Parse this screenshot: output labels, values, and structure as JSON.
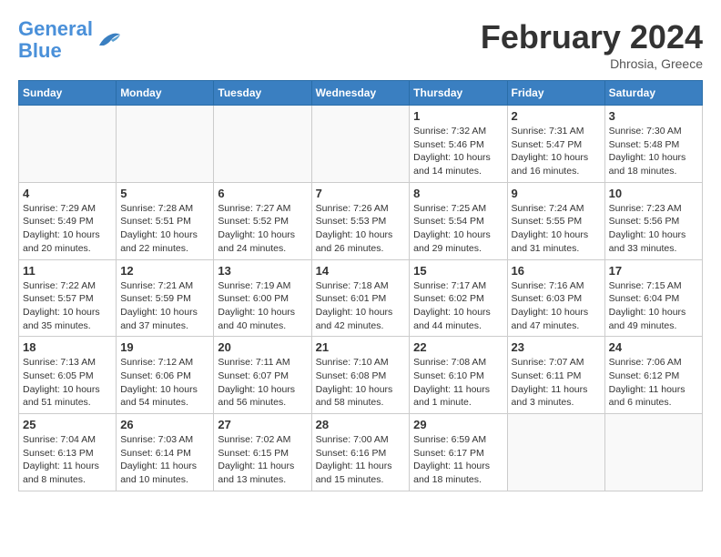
{
  "header": {
    "logo_line1": "General",
    "logo_line2": "Blue",
    "month": "February 2024",
    "location": "Dhrosia, Greece"
  },
  "days_of_week": [
    "Sunday",
    "Monday",
    "Tuesday",
    "Wednesday",
    "Thursday",
    "Friday",
    "Saturday"
  ],
  "weeks": [
    [
      {
        "day": "",
        "info": ""
      },
      {
        "day": "",
        "info": ""
      },
      {
        "day": "",
        "info": ""
      },
      {
        "day": "",
        "info": ""
      },
      {
        "day": "1",
        "info": "Sunrise: 7:32 AM\nSunset: 5:46 PM\nDaylight: 10 hours\nand 14 minutes."
      },
      {
        "day": "2",
        "info": "Sunrise: 7:31 AM\nSunset: 5:47 PM\nDaylight: 10 hours\nand 16 minutes."
      },
      {
        "day": "3",
        "info": "Sunrise: 7:30 AM\nSunset: 5:48 PM\nDaylight: 10 hours\nand 18 minutes."
      }
    ],
    [
      {
        "day": "4",
        "info": "Sunrise: 7:29 AM\nSunset: 5:49 PM\nDaylight: 10 hours\nand 20 minutes."
      },
      {
        "day": "5",
        "info": "Sunrise: 7:28 AM\nSunset: 5:51 PM\nDaylight: 10 hours\nand 22 minutes."
      },
      {
        "day": "6",
        "info": "Sunrise: 7:27 AM\nSunset: 5:52 PM\nDaylight: 10 hours\nand 24 minutes."
      },
      {
        "day": "7",
        "info": "Sunrise: 7:26 AM\nSunset: 5:53 PM\nDaylight: 10 hours\nand 26 minutes."
      },
      {
        "day": "8",
        "info": "Sunrise: 7:25 AM\nSunset: 5:54 PM\nDaylight: 10 hours\nand 29 minutes."
      },
      {
        "day": "9",
        "info": "Sunrise: 7:24 AM\nSunset: 5:55 PM\nDaylight: 10 hours\nand 31 minutes."
      },
      {
        "day": "10",
        "info": "Sunrise: 7:23 AM\nSunset: 5:56 PM\nDaylight: 10 hours\nand 33 minutes."
      }
    ],
    [
      {
        "day": "11",
        "info": "Sunrise: 7:22 AM\nSunset: 5:57 PM\nDaylight: 10 hours\nand 35 minutes."
      },
      {
        "day": "12",
        "info": "Sunrise: 7:21 AM\nSunset: 5:59 PM\nDaylight: 10 hours\nand 37 minutes."
      },
      {
        "day": "13",
        "info": "Sunrise: 7:19 AM\nSunset: 6:00 PM\nDaylight: 10 hours\nand 40 minutes."
      },
      {
        "day": "14",
        "info": "Sunrise: 7:18 AM\nSunset: 6:01 PM\nDaylight: 10 hours\nand 42 minutes."
      },
      {
        "day": "15",
        "info": "Sunrise: 7:17 AM\nSunset: 6:02 PM\nDaylight: 10 hours\nand 44 minutes."
      },
      {
        "day": "16",
        "info": "Sunrise: 7:16 AM\nSunset: 6:03 PM\nDaylight: 10 hours\nand 47 minutes."
      },
      {
        "day": "17",
        "info": "Sunrise: 7:15 AM\nSunset: 6:04 PM\nDaylight: 10 hours\nand 49 minutes."
      }
    ],
    [
      {
        "day": "18",
        "info": "Sunrise: 7:13 AM\nSunset: 6:05 PM\nDaylight: 10 hours\nand 51 minutes."
      },
      {
        "day": "19",
        "info": "Sunrise: 7:12 AM\nSunset: 6:06 PM\nDaylight: 10 hours\nand 54 minutes."
      },
      {
        "day": "20",
        "info": "Sunrise: 7:11 AM\nSunset: 6:07 PM\nDaylight: 10 hours\nand 56 minutes."
      },
      {
        "day": "21",
        "info": "Sunrise: 7:10 AM\nSunset: 6:08 PM\nDaylight: 10 hours\nand 58 minutes."
      },
      {
        "day": "22",
        "info": "Sunrise: 7:08 AM\nSunset: 6:10 PM\nDaylight: 11 hours\nand 1 minute."
      },
      {
        "day": "23",
        "info": "Sunrise: 7:07 AM\nSunset: 6:11 PM\nDaylight: 11 hours\nand 3 minutes."
      },
      {
        "day": "24",
        "info": "Sunrise: 7:06 AM\nSunset: 6:12 PM\nDaylight: 11 hours\nand 6 minutes."
      }
    ],
    [
      {
        "day": "25",
        "info": "Sunrise: 7:04 AM\nSunset: 6:13 PM\nDaylight: 11 hours\nand 8 minutes."
      },
      {
        "day": "26",
        "info": "Sunrise: 7:03 AM\nSunset: 6:14 PM\nDaylight: 11 hours\nand 10 minutes."
      },
      {
        "day": "27",
        "info": "Sunrise: 7:02 AM\nSunset: 6:15 PM\nDaylight: 11 hours\nand 13 minutes."
      },
      {
        "day": "28",
        "info": "Sunrise: 7:00 AM\nSunset: 6:16 PM\nDaylight: 11 hours\nand 15 minutes."
      },
      {
        "day": "29",
        "info": "Sunrise: 6:59 AM\nSunset: 6:17 PM\nDaylight: 11 hours\nand 18 minutes."
      },
      {
        "day": "",
        "info": ""
      },
      {
        "day": "",
        "info": ""
      }
    ]
  ]
}
